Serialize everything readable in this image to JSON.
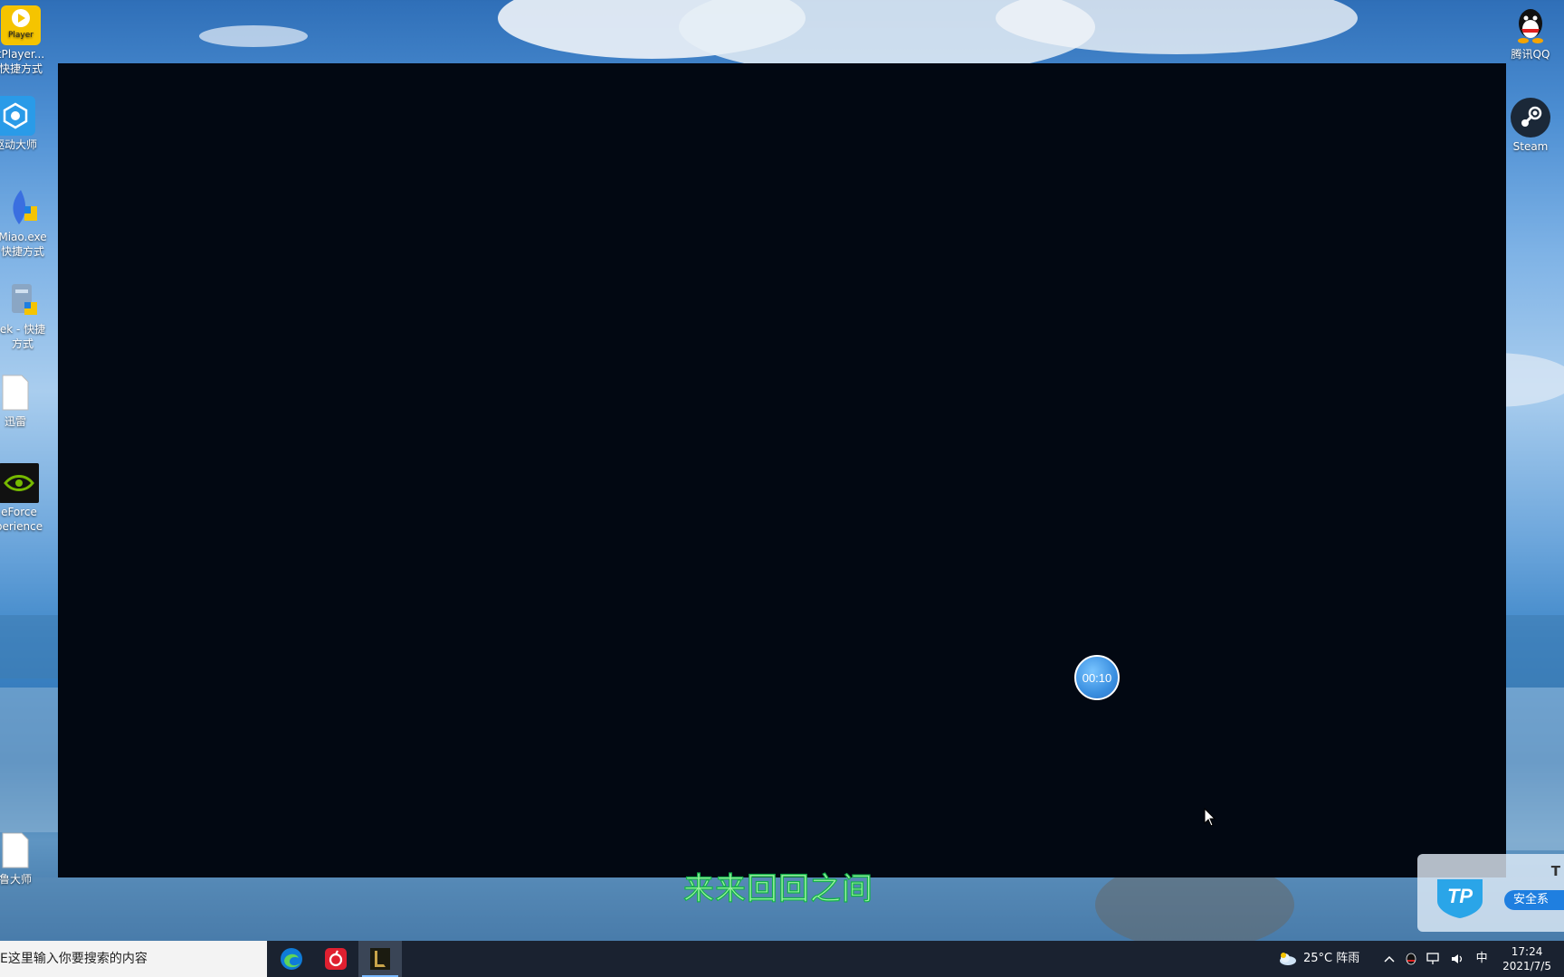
{
  "desktop": {
    "left_icons": [
      {
        "label": "tPlayer...\n快捷方式",
        "icon": "player-icon"
      },
      {
        "label": "驱动大师",
        "icon": "driver-master-icon"
      },
      {
        "label": "Miao.exe\n快捷方式",
        "icon": "miao-icon"
      },
      {
        "label": "ek - 快捷\n方式",
        "icon": "app-shortcut-icon"
      },
      {
        "label": "迅雷",
        "icon": "file-icon"
      },
      {
        "label": "eForce\nperience",
        "icon": "nvidia-icon"
      },
      {
        "label": "鲁大师",
        "icon": "file-icon"
      }
    ],
    "right_icons": [
      {
        "label": "腾讯QQ",
        "icon": "qq-icon"
      },
      {
        "label": "Steam",
        "icon": "steam-icon"
      }
    ],
    "player_badge": "Player"
  },
  "overlay": {
    "timer": "00:10",
    "lyric": "来来回回之间"
  },
  "security_popup": {
    "title_partial": "T",
    "button": "安全系",
    "logo_text": "TP"
  },
  "taskbar": {
    "search_placeholder": "E这里输入你要搜索的内容",
    "apps": [
      {
        "name": "edge-icon",
        "active": false
      },
      {
        "name": "netease-music-icon",
        "active": false
      },
      {
        "name": "league-of-legends-icon",
        "active": true
      }
    ],
    "weather": "25°C 阵雨",
    "ime": "中",
    "time": "17:24",
    "date": "2021/7/5"
  }
}
